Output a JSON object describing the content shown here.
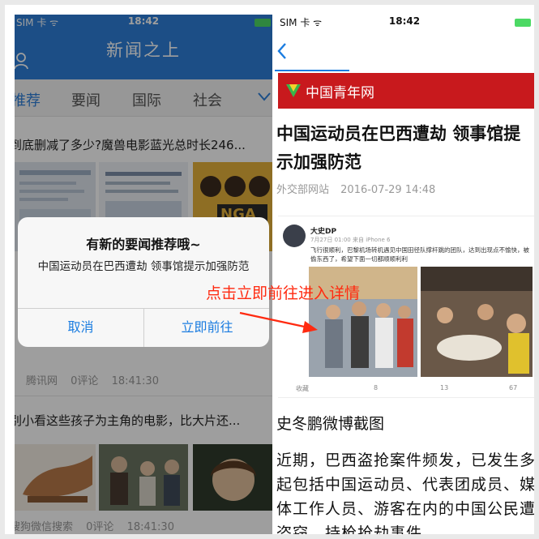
{
  "left": {
    "status": {
      "carrier": "SIM 卡 ᯤ",
      "time": "18:42"
    },
    "header": {
      "title": "新闻之上"
    },
    "tabs": [
      {
        "label": "推荐",
        "active": true
      },
      {
        "label": "要闻",
        "active": false
      },
      {
        "label": "国际",
        "active": false
      },
      {
        "label": "社会",
        "active": false
      }
    ],
    "news": [
      {
        "title": "到底删减了多少?魔兽电影蓝光总时长246...",
        "source": "腾讯网",
        "comments": "0评论",
        "time": "18:41:30"
      },
      {
        "title": "别小看这些孩子为主角的电影，比大片还...",
        "source": "搜狗微信搜索",
        "comments": "0评论",
        "time": "18:41:30"
      }
    ],
    "alert": {
      "title": "有新的要闻推荐哦~",
      "message": "中国运动员在巴西遭劫 领事馆提示加强防范",
      "cancel": "取消",
      "confirm": "立即前往"
    }
  },
  "annotation": {
    "text": "点击立即前往进入详情",
    "color": "#ff2a10"
  },
  "right": {
    "status": {
      "carrier": "SIM 卡 ᯤ",
      "time": "18:42"
    },
    "brand": {
      "name": "中国青年网",
      "color": "#c8191d"
    },
    "headline": "中国运动员在巴西遭劫 领事馆提示加强防范",
    "source": {
      "name": "外交部网站",
      "datetime": "2016-07-29 14:48"
    },
    "weibo": {
      "user": "大史DP",
      "meta": "7月27日 01:00 来自 iPhone 6",
      "text": "飞行很顺利，巴黎机场转机遇见中国田径队撑杆跳的团队，达到出现点不愉快，被偷东西了，希望下面一切都顺顺利利",
      "actions": {
        "fav": "收藏",
        "repost": "8",
        "comment": "13",
        "like": "67"
      }
    },
    "caption": "史冬鹏微博截图",
    "body": [
      "近期，巴西盗抢案件频发，已发生多",
      "起包括中国运动员、代表团成员、媒",
      "体工作人员、游客在内的中国公民遭",
      "盗窃、持枪抢劫事件"
    ]
  },
  "colors": {
    "accent_blue": "#2e7fd8",
    "link_blue": "#1a7ce0",
    "brand_red": "#c8191d"
  }
}
